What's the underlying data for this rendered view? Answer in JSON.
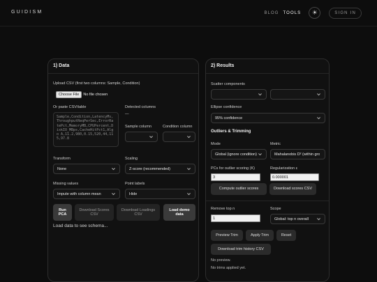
{
  "header": {
    "brand": "GUIDISM",
    "nav": [
      "BLOG",
      "TOOLS"
    ],
    "signin": "SIGN IN",
    "theme_icon": "sun-icon"
  },
  "data_panel": {
    "title": "1) Data",
    "upload_label": "Upload CSV (first two columns: Sample, Condition)",
    "choose_file": "Choose File",
    "no_file": "No file chosen",
    "paste_label": "Or paste CSV/table",
    "paste_placeholder": "Sample,Condition,LatencyMs,ThroughputReqPerSec,ErrorRatePct,MemoryMB,CPUPercent,DiskIO_MBps,CacheHitPct1,Algo A,11.2,980,0.15,520,44,115,97.8",
    "detected_label": "Detected columns",
    "detected_value": "—",
    "sample_col_label": "Sample column",
    "condition_col_label": "Condition column",
    "transform_label": "Transform",
    "transform_value": "None",
    "scaling_label": "Scaling",
    "scaling_value": "Z-score (recommended)",
    "missing_label": "Missing values",
    "missing_value": "Impute with column mean",
    "point_labels_label": "Point labels",
    "point_labels_value": "Hide",
    "run_pca": "Run PCA",
    "download_scores": "Download Scores CSV",
    "download_loadings": "Download Loadings CSV",
    "load_demo": "Load demo data",
    "status": "Load data to see schema..."
  },
  "results_panel": {
    "title": "2) Results",
    "scatter_label": "Scatter components",
    "ellipse_label": "Ellipse confidence",
    "ellipse_value": "95% confidence",
    "outliers_title": "Outliers & Trimming",
    "mode_label": "Mode",
    "mode_value": "Global (ignore condition)",
    "metric_label": "Metric",
    "metric_value": "Mahalanobis D² (within gro",
    "pcs_label": "PCs for outlier scoring (K)",
    "pcs_value": "3",
    "reg_label": "Regularization ε",
    "reg_value": "0.000001",
    "compute_btn": "Compute outlier scores",
    "download_scores_btn": "Download scores CSV",
    "remove_label": "Remove top n",
    "remove_value": "1",
    "scope_label": "Scope",
    "scope_value": "Global: top n overall",
    "preview_btn": "Preview Trim",
    "apply_btn": "Apply Trim",
    "reset_btn": "Reset",
    "history_btn": "Download trim history CSV",
    "no_preview": "No preview.",
    "no_trims": "No trims applied yet."
  }
}
